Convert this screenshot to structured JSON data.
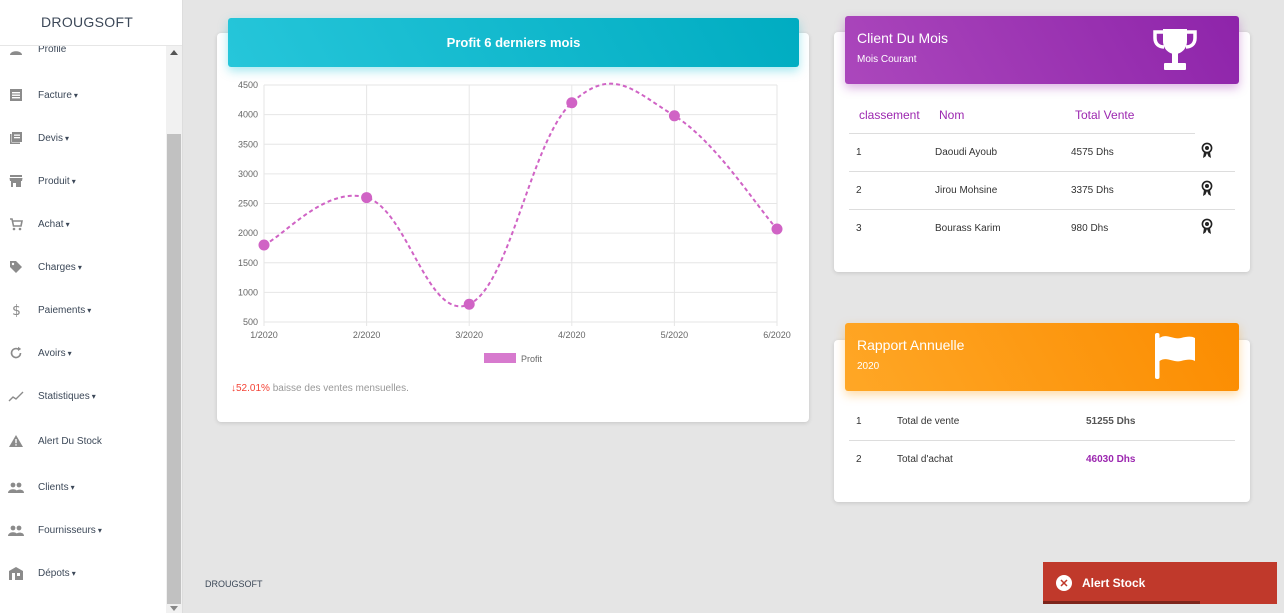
{
  "app": {
    "brand": "DROUGSOFT",
    "footer_brand": "DROUGSOFT"
  },
  "sidebar": {
    "items": [
      {
        "label": "Profile",
        "icon": "profile-icon",
        "caret": ""
      },
      {
        "label": "Facture",
        "icon": "invoice-icon",
        "caret": "▾"
      },
      {
        "label": "Devis",
        "icon": "quote-icon",
        "caret": "▾"
      },
      {
        "label": "Produit",
        "icon": "store-icon",
        "caret": "▾"
      },
      {
        "label": "Achat",
        "icon": "cart-icon",
        "caret": "▾"
      },
      {
        "label": "Charges",
        "icon": "tag-icon",
        "caret": "▾"
      },
      {
        "label": "Paiements",
        "icon": "dollar-icon",
        "caret": "▾"
      },
      {
        "label": "Avoirs",
        "icon": "refresh-icon",
        "caret": "▾"
      },
      {
        "label": "Statistiques",
        "icon": "trend-icon",
        "caret": "▾"
      },
      {
        "label": "Alert Du Stock",
        "icon": "warning-icon",
        "caret": ""
      },
      {
        "label": "Clients",
        "icon": "people-icon",
        "caret": "▾"
      },
      {
        "label": "Fournisseurs",
        "icon": "people-icon",
        "caret": "▾"
      },
      {
        "label": "Dépots",
        "icon": "warehouse-icon",
        "caret": "▾"
      }
    ]
  },
  "profit_card": {
    "title": "Profit 6 derniers mois",
    "footer_value": "52.01%",
    "footer_text": " baisse des ventes mensuelles.",
    "colors": {
      "header": "#00acc1",
      "line": "#d063c5"
    }
  },
  "chart_data": {
    "type": "line",
    "categories": [
      "1/2020",
      "2/2020",
      "3/2020",
      "4/2020",
      "5/2020",
      "6/2020"
    ],
    "series": [
      {
        "name": "Profit",
        "values": [
          1800,
          2600,
          800,
          4200,
          3980,
          2070
        ]
      }
    ],
    "ylim": [
      500,
      4500
    ],
    "yticks": [
      500,
      1000,
      1500,
      2000,
      2500,
      3000,
      3500,
      4000,
      4500
    ],
    "grid": true,
    "legend": "bottom"
  },
  "client_card": {
    "title": "Client Du Mois",
    "subtitle": "Mois Courant",
    "columns": [
      "classement",
      "Nom",
      "Total Vente"
    ],
    "rows": [
      {
        "rank": "1",
        "name": "Daoudi Ayoub",
        "total": "4575 Dhs"
      },
      {
        "rank": "2",
        "name": "Jirou Mohsine",
        "total": "3375 Dhs"
      },
      {
        "rank": "3",
        "name": "Bourass Karim",
        "total": "980 Dhs"
      }
    ]
  },
  "rapport_card": {
    "title": "Rapport Annuelle",
    "subtitle": "2020",
    "rows": [
      {
        "num": "1",
        "label": "Total de vente",
        "value": "51255 Dhs"
      },
      {
        "num": "2",
        "label": "Total d'achat",
        "value": "46030 Dhs"
      }
    ]
  },
  "alert": {
    "label": "Alert Stock"
  }
}
